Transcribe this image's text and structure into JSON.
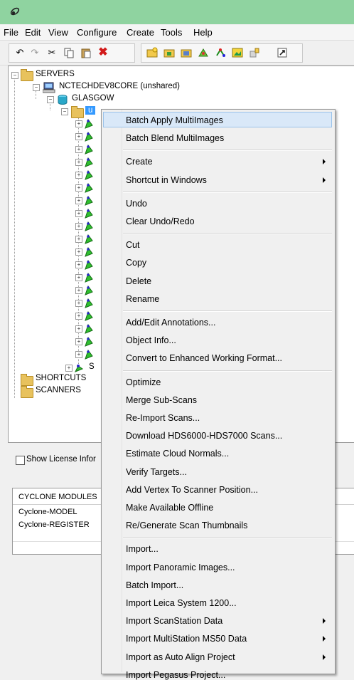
{
  "menubar": {
    "items": [
      "File",
      "Edit",
      "View",
      "Configure",
      "Create",
      "Tools",
      "Help"
    ]
  },
  "toolbar": {
    "icons": [
      "undo-icon",
      "redo-icon",
      "cut-icon",
      "copy-icon",
      "paste-icon",
      "delete-icon",
      "folder-new-icon",
      "folder-open-icon",
      "folder-image-icon",
      "scan-icon",
      "register-icon",
      "image-icon",
      "database-icon",
      "help-icon"
    ]
  },
  "tree": {
    "root": "SERVERS",
    "server": "NCTECHDEV8CORE (unshared)",
    "database": "GLASGOW",
    "selected_project": "u",
    "partial_item": "S",
    "shortcuts": "SHORTCUTS",
    "scanners": "SCANNERS"
  },
  "license": {
    "label": "Show License Infor"
  },
  "modules": {
    "header": "CYCLONE MODULES",
    "rows": [
      "Cyclone-MODEL",
      "Cyclone-REGISTER"
    ]
  },
  "context_menu": {
    "items": [
      {
        "label": "Batch Apply MultiImages",
        "highlight": true
      },
      {
        "label": "Batch Blend MultiImages"
      },
      {
        "sep": true
      },
      {
        "label": "Create",
        "submenu": true
      },
      {
        "label": "Shortcut in Windows",
        "submenu": true
      },
      {
        "sep": true
      },
      {
        "label": "Undo"
      },
      {
        "label": "Clear Undo/Redo"
      },
      {
        "sep": true
      },
      {
        "label": "Cut"
      },
      {
        "label": "Copy"
      },
      {
        "label": "Delete"
      },
      {
        "label": "Rename"
      },
      {
        "sep": true
      },
      {
        "label": "Add/Edit Annotations..."
      },
      {
        "label": "Object Info..."
      },
      {
        "label": "Convert to Enhanced Working Format..."
      },
      {
        "sep": true
      },
      {
        "label": "Optimize"
      },
      {
        "label": "Merge Sub-Scans"
      },
      {
        "label": "Re-Import Scans..."
      },
      {
        "label": "Download HDS6000-HDS7000 Scans..."
      },
      {
        "label": "Estimate Cloud Normals..."
      },
      {
        "label": "Verify Targets..."
      },
      {
        "label": "Add Vertex To Scanner Position..."
      },
      {
        "label": "Make Available Offline"
      },
      {
        "label": "Re/Generate Scan Thumbnails"
      },
      {
        "sep": true
      },
      {
        "label": "Import..."
      },
      {
        "label": "Import Panoramic Images..."
      },
      {
        "label": "Batch Import..."
      },
      {
        "label": "Import Leica System 1200..."
      },
      {
        "label": "Import ScanStation Data",
        "submenu": true
      },
      {
        "label": "Import MultiStation MS50 Data",
        "submenu": true
      },
      {
        "label": "Import as Auto Align Project",
        "submenu": true
      },
      {
        "label": "Import Pegasus Project..."
      }
    ]
  },
  "colors": {
    "titlebar": "#8fd3a0",
    "highlight": "#d9e8f8",
    "folder": "#e8c25d",
    "database": "#2aa8c9"
  }
}
